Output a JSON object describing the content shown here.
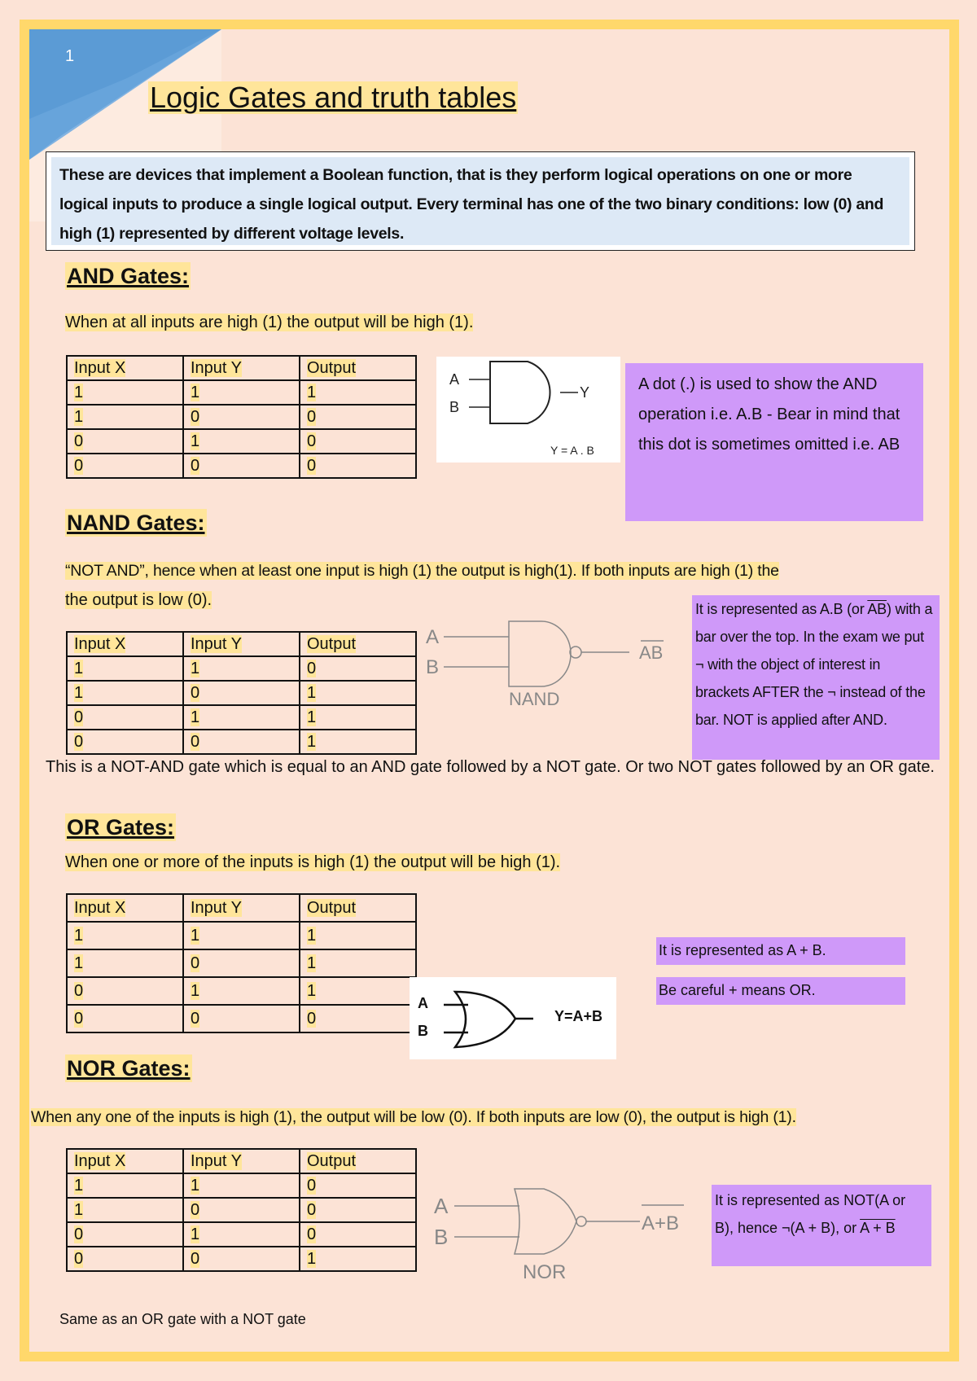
{
  "page": {
    "number": "1",
    "title": "Logic Gates and truth tables",
    "intro": "These are devices that implement a Boolean function, that is they perform logical operations on one or more logical inputs to produce a single logical output. Every terminal has one of the two binary conditions: low (0) and high (1) represented by different voltage levels.",
    "colors": {
      "background": "#fce3d6",
      "border": "#ffd86b",
      "highlight": "#ffe59a",
      "note": "#cf99f9",
      "intro_bg": "#dde9f6",
      "corner_blue": "#5b9bd5"
    }
  },
  "table_headers": [
    "Input X",
    "Input Y",
    "Output"
  ],
  "sections": {
    "and": {
      "heading": "AND Gates:",
      "description": "When at all inputs are high (1) the output will be high (1).",
      "rows": [
        [
          "1",
          "1",
          "1"
        ],
        [
          "1",
          "0",
          "0"
        ],
        [
          "0",
          "1",
          "0"
        ],
        [
          "0",
          "0",
          "0"
        ]
      ],
      "diagram": {
        "input_a": "A",
        "input_b": "B",
        "output": "Y",
        "equation": "Y = A . B"
      },
      "note": "A dot (.) is used to show the AND operation i.e. A.B  - Bear in mind that this dot is sometimes omitted i.e. AB"
    },
    "nand": {
      "heading": "NAND Gates:",
      "description_line1": "“NOT AND”, hence when at least one input is high (1) the output is high(1). If both inputs are high (1) the",
      "description_line2": "the output is low (0).",
      "rows": [
        [
          "1",
          "1",
          "0"
        ],
        [
          "1",
          "0",
          "1"
        ],
        [
          "0",
          "1",
          "1"
        ],
        [
          "0",
          "0",
          "1"
        ]
      ],
      "diagram": {
        "input_a": "A",
        "input_b": "B",
        "output": "AB",
        "name": "NAND"
      },
      "note_prefix": "It is represented as A.B (or ",
      "note_bar": "AB",
      "note_suffix": ") with a bar over the top. In the exam we put ¬  with the object of interest in brackets AFTER the ¬ instead of the bar. NOT is applied  after AND.",
      "explanation": "This is a NOT-AND gate which is equal to an AND gate followed by a NOT gate. Or two NOT gates followed by an OR gate."
    },
    "or": {
      "heading": "OR Gates:",
      "description": "When one or more of the inputs is high (1) the output will be high (1).",
      "rows": [
        [
          "1",
          "1",
          "1"
        ],
        [
          "1",
          "0",
          "1"
        ],
        [
          "0",
          "1",
          "1"
        ],
        [
          "0",
          "0",
          "0"
        ]
      ],
      "diagram": {
        "input_a": "A",
        "input_b": "B",
        "equation": "Y=A+B"
      },
      "note1": "It is represented as A + B.",
      "note2": "Be careful + means OR."
    },
    "nor": {
      "heading": "NOR Gates:",
      "description": "When any one of the inputs is high (1), the output will be low (0). If both inputs are low (0), the output is high (1).",
      "rows": [
        [
          "1",
          "1",
          "0"
        ],
        [
          "1",
          "0",
          "0"
        ],
        [
          "0",
          "1",
          "0"
        ],
        [
          "0",
          "0",
          "1"
        ]
      ],
      "diagram": {
        "input_a": "A",
        "input_b": "B",
        "output": "A+B",
        "name": "NOR"
      },
      "note_prefix": "It is represented as NOT(A or B), hence ¬(A + B), or ",
      "note_bar": "A + B",
      "footer": "Same as an OR gate with a  NOT gate"
    }
  }
}
